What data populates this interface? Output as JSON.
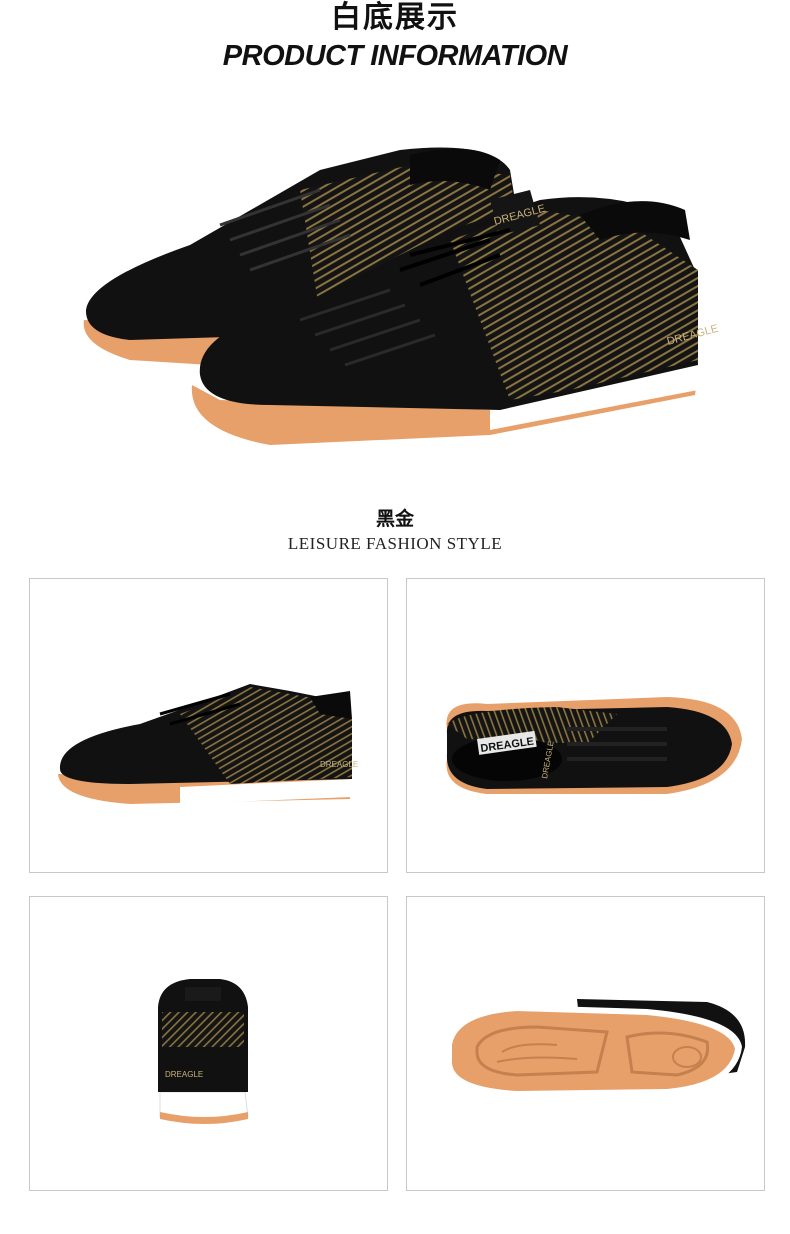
{
  "header": {
    "title_cn": "白底展示",
    "title_en": "PRODUCT INFORMATION"
  },
  "color_section": {
    "name_cn": "黑金",
    "subtitle_en": "LEISURE FASHION STYLE"
  },
  "brand": {
    "logo_text": "DREAGLE"
  },
  "colors": {
    "upper": "#111111",
    "gold": "#8a7440",
    "gum_sole": "#e8a06a",
    "midsole": "#ffffff",
    "panel_border": "#c8c8c8"
  },
  "views": [
    "side-view",
    "top-view",
    "back-view",
    "sole-view"
  ]
}
